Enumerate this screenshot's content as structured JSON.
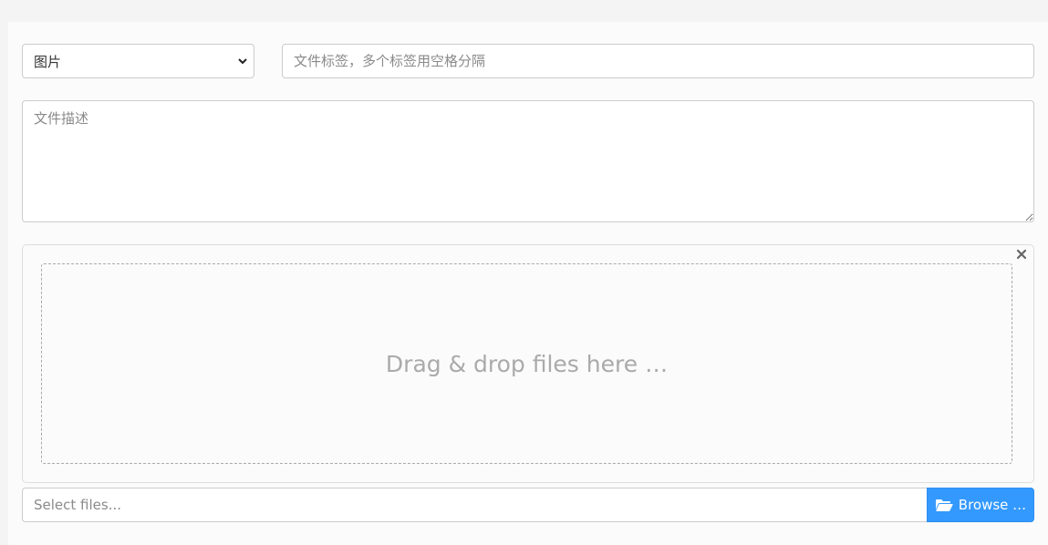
{
  "form": {
    "type_select": {
      "selected": "图片"
    },
    "tags_input": {
      "placeholder": "文件标签，多个标签用空格分隔",
      "value": ""
    },
    "description": {
      "placeholder": "文件描述",
      "value": ""
    }
  },
  "uploader": {
    "drop_text": "Drag & drop files here …",
    "caption_placeholder": "Select files...",
    "browse_label": "Browse …",
    "close_icon": "close-icon",
    "browse_icon": "folder-open-icon"
  },
  "colors": {
    "accent": "#3399ff",
    "page_bg": "#f4f4f4",
    "panel_bg": "#fbfbfb",
    "border": "#cccccc",
    "drop_text": "#aaaaaa"
  }
}
